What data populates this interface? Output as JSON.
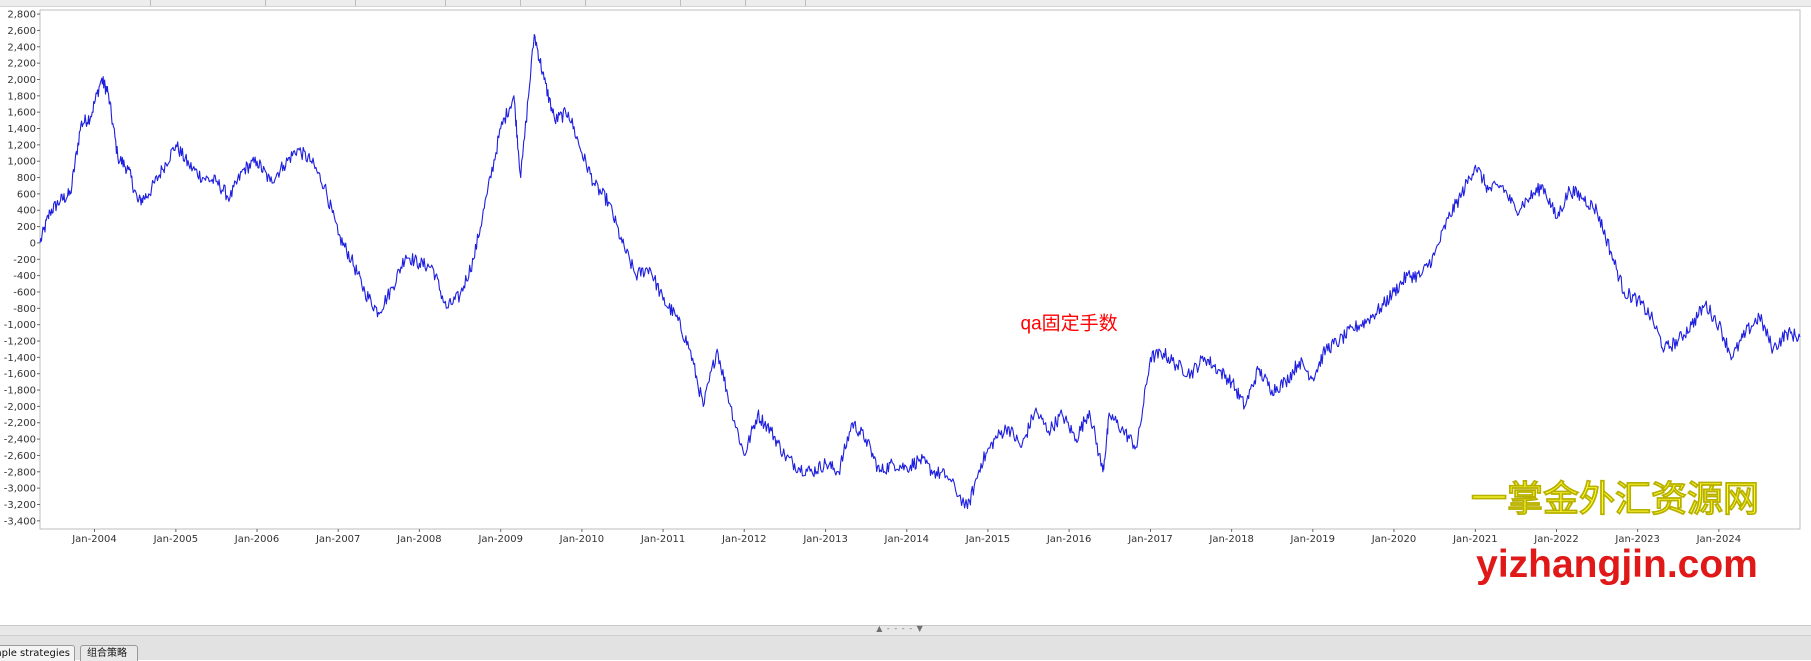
{
  "window": {
    "tabs": [
      {
        "label": "Simple strategies"
      },
      {
        "label": "组合策略"
      }
    ],
    "splitter_grip": "▲ - - - - ▼"
  },
  "colors": {
    "series_line": "#1f1fe0",
    "grid": "#d4d4d4",
    "annotation": "#ff0000",
    "watermark_title": "#ffff33",
    "watermark_url": "#e01818"
  },
  "watermark": {
    "title": "一掌金外汇资源网",
    "url": "yizhangjin.com"
  },
  "chart_data": {
    "type": "line",
    "title": "",
    "xlabel": "",
    "ylabel": "",
    "grid": true,
    "legend": "none",
    "x_range": [
      "2003-05-01",
      "2024-12-31"
    ],
    "ylim": [
      -3500,
      2850
    ],
    "y_ticks": [
      2800,
      2600,
      2400,
      2200,
      2000,
      1800,
      1600,
      1400,
      1200,
      1000,
      800,
      600,
      400,
      200,
      0,
      -200,
      -400,
      -600,
      -800,
      -1000,
      -1200,
      -1400,
      -1600,
      -1800,
      -2000,
      -2200,
      -2400,
      -2600,
      -2800,
      -3000,
      -3200,
      -3400
    ],
    "x_ticks": [
      "Jan-2004",
      "Jan-2005",
      "Jan-2006",
      "Jan-2007",
      "Jan-2008",
      "Jan-2009",
      "Jan-2010",
      "Jan-2011",
      "Jan-2012",
      "Jan-2013",
      "Jan-2014",
      "Jan-2015",
      "Jan-2016",
      "Jan-2017",
      "Jan-2018",
      "Jan-2019",
      "Jan-2020",
      "Jan-2021",
      "Jan-2022",
      "Jan-2023",
      "Jan-2024"
    ],
    "annotations": [
      {
        "text": "qa固定手数",
        "x": "2016-01-01",
        "y": -1060
      }
    ],
    "series": [
      {
        "points": [
          [
            "2003-05-01",
            0
          ],
          [
            "2003-06-15",
            380
          ],
          [
            "2003-08-01",
            520
          ],
          [
            "2003-09-15",
            600
          ],
          [
            "2003-11-01",
            1450
          ],
          [
            "2003-12-15",
            1550
          ],
          [
            "2004-02-01",
            2000
          ],
          [
            "2004-03-01",
            1850
          ],
          [
            "2004-04-15",
            1050
          ],
          [
            "2004-06-01",
            900
          ],
          [
            "2004-07-15",
            500
          ],
          [
            "2004-09-01",
            600
          ],
          [
            "2004-11-01",
            900
          ],
          [
            "2005-01-01",
            1200
          ],
          [
            "2005-03-01",
            950
          ],
          [
            "2005-05-01",
            800
          ],
          [
            "2005-07-01",
            750
          ],
          [
            "2005-09-01",
            550
          ],
          [
            "2005-11-01",
            900
          ],
          [
            "2006-01-01",
            1000
          ],
          [
            "2006-03-01",
            750
          ],
          [
            "2006-05-01",
            950
          ],
          [
            "2006-07-01",
            1150
          ],
          [
            "2006-09-01",
            1000
          ],
          [
            "2006-11-01",
            700
          ],
          [
            "2007-01-01",
            100
          ],
          [
            "2007-03-01",
            -200
          ],
          [
            "2007-05-01",
            -600
          ],
          [
            "2007-07-01",
            -850
          ],
          [
            "2007-09-01",
            -550
          ],
          [
            "2007-11-01",
            -150
          ],
          [
            "2008-01-01",
            -250
          ],
          [
            "2008-03-01",
            -300
          ],
          [
            "2008-05-01",
            -800
          ],
          [
            "2008-07-01",
            -650
          ],
          [
            "2008-09-01",
            -200
          ],
          [
            "2008-11-01",
            600
          ],
          [
            "2009-01-01",
            1400
          ],
          [
            "2009-03-01",
            1800
          ],
          [
            "2009-04-01",
            800
          ],
          [
            "2009-06-01",
            2550
          ],
          [
            "2009-07-15",
            2000
          ],
          [
            "2009-09-01",
            1500
          ],
          [
            "2009-11-01",
            1600
          ],
          [
            "2010-01-01",
            1100
          ],
          [
            "2010-03-01",
            700
          ],
          [
            "2010-05-01",
            500
          ],
          [
            "2010-07-01",
            0
          ],
          [
            "2010-09-01",
            -400
          ],
          [
            "2010-11-01",
            -300
          ],
          [
            "2011-01-01",
            -700
          ],
          [
            "2011-03-01",
            -900
          ],
          [
            "2011-05-01",
            -1300
          ],
          [
            "2011-07-01",
            -2000
          ],
          [
            "2011-09-01",
            -1300
          ],
          [
            "2011-11-01",
            -2000
          ],
          [
            "2012-01-01",
            -2600
          ],
          [
            "2012-03-01",
            -2100
          ],
          [
            "2012-05-01",
            -2300
          ],
          [
            "2012-07-01",
            -2600
          ],
          [
            "2012-09-01",
            -2750
          ],
          [
            "2012-11-01",
            -2800
          ],
          [
            "2013-01-01",
            -2700
          ],
          [
            "2013-03-01",
            -2800
          ],
          [
            "2013-05-01",
            -2200
          ],
          [
            "2013-07-01",
            -2400
          ],
          [
            "2013-09-01",
            -2800
          ],
          [
            "2013-11-01",
            -2700
          ],
          [
            "2014-01-01",
            -2750
          ],
          [
            "2014-03-01",
            -2650
          ],
          [
            "2014-05-01",
            -2800
          ],
          [
            "2014-07-01",
            -2850
          ],
          [
            "2014-10-01",
            -3250
          ],
          [
            "2014-12-01",
            -2700
          ],
          [
            "2015-02-01",
            -2400
          ],
          [
            "2015-04-01",
            -2250
          ],
          [
            "2015-06-01",
            -2500
          ],
          [
            "2015-08-01",
            -2050
          ],
          [
            "2015-10-01",
            -2300
          ],
          [
            "2015-12-01",
            -2100
          ],
          [
            "2016-02-01",
            -2400
          ],
          [
            "2016-04-01",
            -2050
          ],
          [
            "2016-06-01",
            -2800
          ],
          [
            "2016-07-01",
            -2100
          ],
          [
            "2016-09-01",
            -2300
          ],
          [
            "2016-11-01",
            -2500
          ],
          [
            "2017-01-01",
            -1400
          ],
          [
            "2017-03-01",
            -1350
          ],
          [
            "2017-05-01",
            -1500
          ],
          [
            "2017-07-01",
            -1600
          ],
          [
            "2017-09-01",
            -1400
          ],
          [
            "2017-11-01",
            -1550
          ],
          [
            "2018-01-01",
            -1700
          ],
          [
            "2018-03-01",
            -2000
          ],
          [
            "2018-05-01",
            -1550
          ],
          [
            "2018-07-01",
            -1800
          ],
          [
            "2018-09-01",
            -1700
          ],
          [
            "2018-11-01",
            -1450
          ],
          [
            "2019-01-01",
            -1650
          ],
          [
            "2019-03-01",
            -1300
          ],
          [
            "2019-05-01",
            -1200
          ],
          [
            "2019-07-01",
            -1050
          ],
          [
            "2019-09-01",
            -950
          ],
          [
            "2019-11-01",
            -800
          ],
          [
            "2020-01-01",
            -600
          ],
          [
            "2020-03-01",
            -400
          ],
          [
            "2020-05-01",
            -400
          ],
          [
            "2020-07-01",
            -150
          ],
          [
            "2020-09-01",
            300
          ],
          [
            "2020-11-01",
            600
          ],
          [
            "2021-01-01",
            950
          ],
          [
            "2021-03-01",
            650
          ],
          [
            "2021-05-01",
            700
          ],
          [
            "2021-07-01",
            400
          ],
          [
            "2021-09-01",
            550
          ],
          [
            "2021-11-01",
            700
          ],
          [
            "2022-01-01",
            300
          ],
          [
            "2022-03-01",
            650
          ],
          [
            "2022-05-01",
            550
          ],
          [
            "2022-07-01",
            400
          ],
          [
            "2022-09-01",
            -100
          ],
          [
            "2022-11-01",
            -600
          ],
          [
            "2023-01-01",
            -700
          ],
          [
            "2023-03-01",
            -900
          ],
          [
            "2023-05-01",
            -1300
          ],
          [
            "2023-07-01",
            -1200
          ],
          [
            "2023-09-01",
            -1000
          ],
          [
            "2023-11-01",
            -750
          ],
          [
            "2024-01-01",
            -1000
          ],
          [
            "2024-03-01",
            -1400
          ],
          [
            "2024-05-01",
            -1100
          ],
          [
            "2024-07-01",
            -900
          ],
          [
            "2024-09-01",
            -1300
          ],
          [
            "2024-11-01",
            -1100
          ],
          [
            "2024-12-31",
            -1150
          ]
        ]
      }
    ]
  }
}
